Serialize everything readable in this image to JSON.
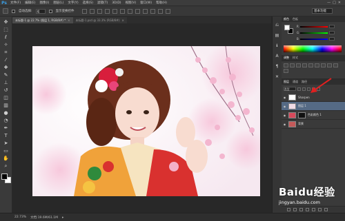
{
  "app": {
    "logo": "Ps",
    "menu": [
      "文件(F)",
      "编辑(E)",
      "图像(I)",
      "图层(L)",
      "文字(Y)",
      "选择(S)",
      "滤镜(T)",
      "3D(D)",
      "视图(V)",
      "窗口(W)",
      "帮助(H)"
    ],
    "window_controls": [
      "—",
      "□",
      "✕"
    ]
  },
  "options": {
    "auto_select_label": "自动选择:",
    "auto_select_value": "组",
    "show_transform_label": "显示变换控件",
    "workspace": "基本功能"
  },
  "documents": {
    "tabs": [
      {
        "label": "未标题-1 @ 22.7% (图层 1, RGB/8#) *"
      },
      {
        "label": "未标题-1.psd @ 33.3% (RGB/8#)"
      }
    ],
    "close_glyph": "×"
  },
  "status": {
    "zoom": "22.73%",
    "doc_info": "文档:19.6M/61.1M"
  },
  "panels": {
    "color_tabs": [
      "颜色",
      "色板"
    ],
    "slider_labels": [
      "R",
      "G",
      "B"
    ],
    "adjustment_tabs": [
      "调整",
      "样式"
    ],
    "layer_tabs": [
      "图层",
      "通道",
      "路径"
    ],
    "layer_kind": "类型",
    "layers": [
      {
        "name": "Sharpen",
        "selected": false
      },
      {
        "name": "图层 1",
        "selected": true
      },
      {
        "name": "色彩颜色 1",
        "selected": false
      },
      {
        "name": "背景",
        "selected": false
      }
    ]
  },
  "watermark": {
    "logo": "Baidu经验",
    "url": "jingyan.baidu.com"
  },
  "icons": {
    "toolbar": [
      "move-icon",
      "marquee-icon",
      "lasso-icon",
      "magic-wand-icon",
      "crop-icon",
      "eyedropper-icon",
      "healing-brush-icon",
      "brush-icon",
      "clone-stamp-icon",
      "history-brush-icon",
      "eraser-icon",
      "gradient-icon",
      "blur-icon",
      "dodge-icon",
      "pen-icon",
      "type-icon",
      "path-select-icon",
      "shape-icon",
      "hand-icon",
      "zoom-icon"
    ]
  },
  "colors": {
    "accent_arrow": "#e02020",
    "selected_layer": "#556a85"
  }
}
